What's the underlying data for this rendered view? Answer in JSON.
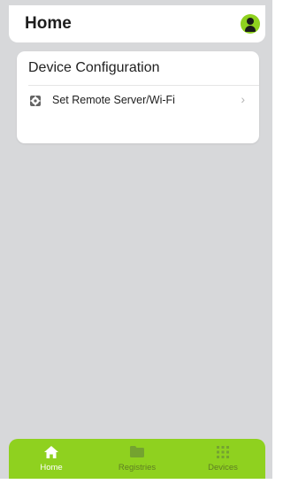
{
  "header": {
    "title": "Home"
  },
  "card": {
    "title": "Device Configuration",
    "rows": [
      {
        "label": "Set Remote Server/Wi-Fi",
        "chevron": "›",
        "icon": "gear-icon"
      }
    ]
  },
  "tabbar": {
    "tabs": [
      {
        "label": "Home",
        "icon": "home-icon",
        "active": true
      },
      {
        "label": "Registries",
        "icon": "folder-icon",
        "active": false
      },
      {
        "label": "Devices",
        "icon": "grid-icon",
        "active": false
      }
    ]
  },
  "colors": {
    "accent": "#8fd11f",
    "background": "#d7d8da",
    "card": "#ffffff"
  }
}
